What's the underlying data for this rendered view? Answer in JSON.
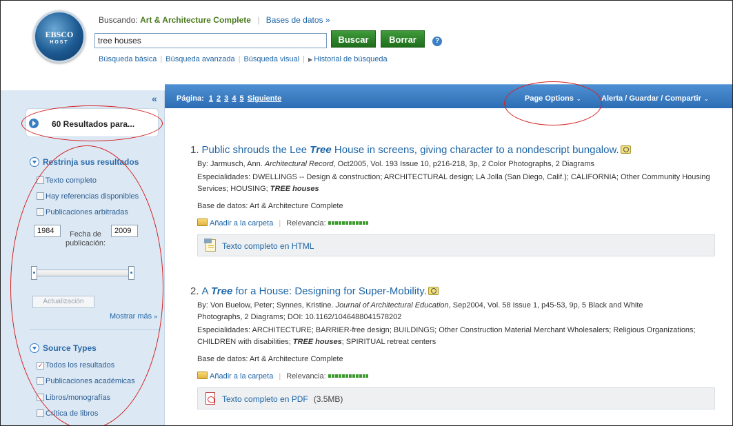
{
  "header": {
    "logo_line1": "EBSCO",
    "logo_line2": "HOST",
    "searching_label": "Buscando:",
    "database_name": "Art & Architecture Complete",
    "databases_link": "Bases de datos »",
    "search_value": "tree houses",
    "search_button": "Buscar",
    "clear_button": "Borrar",
    "help_icon": "?",
    "nav": {
      "basic": "Búsqueda básica",
      "advanced": "Búsqueda avanzada",
      "visual": "Búsqueda visual",
      "history": "Historial de búsqueda"
    }
  },
  "sidebar": {
    "collapse": "«",
    "results_label": "60 Resultados para...",
    "refine_title": "Restrinja sus resultados",
    "refine_options": [
      {
        "label": "Texto completo",
        "checked": false
      },
      {
        "label": "Hay referencias disponibles",
        "checked": false
      },
      {
        "label": "Publicaciones arbitradas",
        "checked": false
      }
    ],
    "year_from": "1984",
    "year_to": "2009",
    "date_label": "Fecha de publicación:",
    "update_button": "Actualización",
    "show_more": "Mostrar más",
    "show_more_arrow": "»",
    "source_title": "Source Types",
    "source_options": [
      {
        "label": "Todos los resultados",
        "checked": true
      },
      {
        "label": "Publicaciones académicas",
        "checked": false
      },
      {
        "label": "Libros/monografías",
        "checked": false
      },
      {
        "label": "Crítica de libros",
        "checked": false
      }
    ]
  },
  "topbar": {
    "page_label": "Página:",
    "pages": [
      "1",
      "2",
      "3",
      "4",
      "5"
    ],
    "next": "Siguiente",
    "page_options": "Page Options",
    "alert_options": "Alerta / Guardar / Compartir"
  },
  "results": [
    {
      "number": "1.",
      "title_before": "Public shrouds the Lee",
      "title_em": "Tree",
      "title_after": "House in screens, giving character to a nondescript bungalow.",
      "meta_prefix": "By: Jarmusch, Ann.",
      "meta_journal": "Architectural Record",
      "meta_rest": ", Oct2005, Vol. 193 Issue 10, p216-218, 3p, 2 Color Photographs, 2 Diagrams",
      "meta_line2": "",
      "subjects_before": "Especialidades: DWELLINGS -- Design & construction; ARCHITECTURAL design; LA Jolla (San Diego, Calif.); CALIFORNIA; Other Community Housing Services; HOUSING;",
      "subjects_em": "TREE houses",
      "subjects_after": "",
      "database": "Base de datos: Art & Architecture Complete",
      "add_folder": "Añadir a la carpeta",
      "relevance": "Relevancia:",
      "fulltext": "Texto completo en HTML",
      "fulltext_extra": ""
    },
    {
      "number": "2.",
      "title_before": "A",
      "title_em": "Tree",
      "title_after": "for a House: Designing for Super-Mobility.",
      "meta_prefix": "By: Von Buelow, Peter; Synnes, Kristine.",
      "meta_journal": "Journal of Architectural Education",
      "meta_rest": ", Sep2004, Vol. 58 Issue 1, p45-53, 9p, 5 Black and White",
      "meta_line2": "Photographs, 2 Diagrams; DOI: 10.1162/1046488041578202",
      "subjects_before": "Especialidades: ARCHITECTURE; BARRIER-free design; BUILDINGS; Other Construction Material Merchant Wholesalers; Religious Organizations; CHILDREN with disabilities;",
      "subjects_em": "TREE houses",
      "subjects_after": "; SPIRITUAL retreat centers",
      "database": "Base de datos: Art & Architecture Complete",
      "add_folder": "Añadir a la carpeta",
      "relevance": "Relevancia:",
      "fulltext": "Texto completo en PDF",
      "fulltext_extra": "(3.5MB)"
    }
  ],
  "colors": {
    "accent_blue": "#2d6db4",
    "button_green": "#1f6d1c",
    "annotation_red": "#d42020"
  }
}
